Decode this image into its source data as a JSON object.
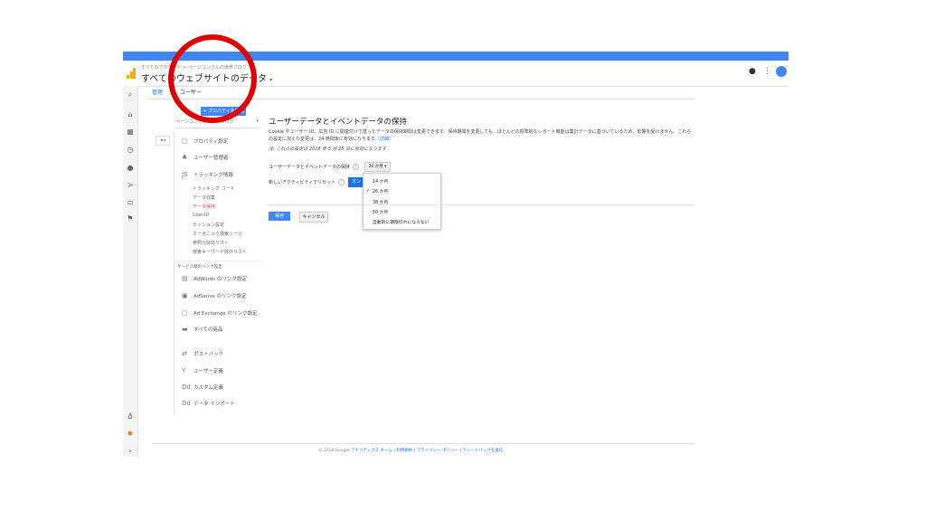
{
  "banner": {
    "text": ""
  },
  "header": {
    "account_path": "すべてのアカウント > ページコンさんの世界ブログ",
    "view_name": "すべてのウェブサイトのデータ",
    "icons": [
      "analytics-logo-icon",
      "notifications-icon",
      "more-vert-icon",
      "account-avatar-icon"
    ]
  },
  "left_nav": {
    "icons": [
      "search-icon",
      "home-icon",
      "customization-icon",
      "realtime-icon",
      "audience-icon",
      "acquisition-icon",
      "behavior-icon",
      "conversions-icon",
      "lightbulb-icon",
      "gear-icon",
      "expand-icon"
    ]
  },
  "tabs": {
    "admin": "管理",
    "user": "ユーザー"
  },
  "property": {
    "add_button": "+ プロパティを作成",
    "selector_label": "ページコンさんの世界ブログ",
    "back_icon": "back-arrow-icon"
  },
  "sidebar": {
    "items": [
      {
        "label": "プロパティ設定",
        "icon": "property-settings-icon"
      },
      {
        "label": "ユーザー管理者",
        "icon": "users-icon"
      },
      {
        "label": "トラッキング情報",
        "icon": "tracking-icon"
      }
    ],
    "tracking_sub": [
      "トラッキング コード",
      "データ収集",
      "データ保持",
      "User-ID",
      "セッション設定",
      "オーガニック検索ソース",
      "参照元除外リスト",
      "検索キーワード除外リスト"
    ],
    "active_sub": "データ保持",
    "section_label": "サービス間のリンク設定",
    "links": [
      {
        "label": "AdWords のリンク設定",
        "icon": "adwords-icon"
      },
      {
        "label": "AdSense のリンク設定",
        "icon": "adsense-icon"
      },
      {
        "label": "Ad Exchange のリンク設定",
        "icon": "adexchange-icon"
      },
      {
        "label": "すべての商品",
        "icon": "all-products-icon"
      },
      {
        "label": "ポストバック",
        "icon": "postback-icon"
      },
      {
        "label": "ユーザー定義",
        "icon": "audience-def-icon"
      },
      {
        "label": "カスタム定義",
        "icon": "custom-def-icon"
      },
      {
        "label": "データ インポート",
        "icon": "data-import-icon"
      }
    ]
  },
  "main": {
    "title": "ユーザーデータとイベントデータの保持",
    "description": "Cookie やユーザー ID、広告 ID に関連付けて送ったデータの保持期間は変更できます。保持期間を変更しても、ほとんどの標準的なレポート機能は集計データに基づいているため、影響を受けません。これらの設定に加えた変更は、24 時間後に有効になります",
    "description_link": "（詳細）",
    "note": "注: これらの設定は 2018 年 5 月 25 日に有効になります",
    "retention_label": "ユーザーデータとイベントデータの保持",
    "retention_selected": "26 か月",
    "reset_label": "新しいアクティビティでリセット",
    "reset_toggle": "オン",
    "retention_options": [
      "14 か月",
      "26 か月",
      "38 か月",
      "50 か月",
      "自動的に期限切れにならない"
    ],
    "save_button": "保存",
    "cancel_button": "キャンセル"
  },
  "footer": {
    "copyright": "© 2018 Google",
    "links": "アナリティクス ホーム | 利用規約 | プライバシー ポリシー | フィードバックを送信"
  },
  "colors": {
    "brand": "#4285f4",
    "accent_red": "#e53935",
    "annotation": "#e00000",
    "logo": "#f9ab00"
  }
}
